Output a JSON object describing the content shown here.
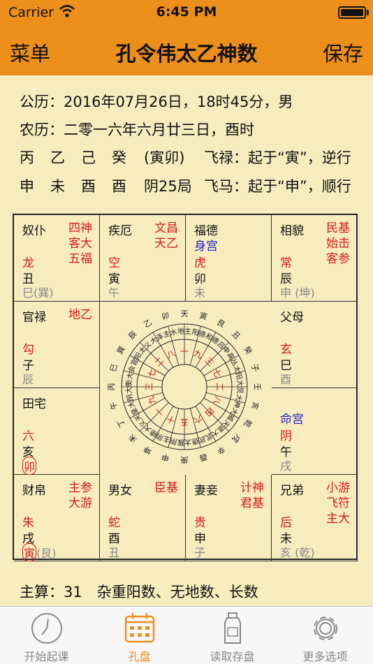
{
  "status_bar": {
    "carrier": "Carrier",
    "time": "6:45 PM"
  },
  "nav": {
    "left": "菜单",
    "title": "孔令伟太乙神数",
    "right": "保存"
  },
  "info": {
    "gregorian": "公历：2016年07月26日，18时45分，男",
    "lunar": "农历：二零一六年六月廿三日，酉时",
    "stems": [
      "丙",
      "乙",
      "己",
      "癸"
    ],
    "stems_extra": "(寅卯)",
    "feilu": "飞禄：起于“寅”，逆行",
    "branches": [
      "申",
      "未",
      "酉",
      "酉"
    ],
    "ju": "阴25局",
    "feima": "飞马：起于“申”，顺行"
  },
  "palaces": [
    {
      "name": "奴仆",
      "stars": [
        "四神",
        "客大",
        "五福"
      ],
      "special": "",
      "general": "龙",
      "branch": "丑",
      "extra": "巳(巽)",
      "circle_extra": ""
    },
    {
      "name": "疾厄",
      "stars": [
        "文昌",
        "天乙"
      ],
      "special": "",
      "general": "空",
      "branch": "寅",
      "extra": "午",
      "circle_extra": ""
    },
    {
      "name": "福德",
      "stars": [],
      "special": "身宫",
      "general": "虎",
      "branch": "卯",
      "extra": "未",
      "circle_extra": ""
    },
    {
      "name": "相貌",
      "stars": [
        "民基",
        "始击",
        "客参"
      ],
      "special": "",
      "general": "常",
      "branch": "辰",
      "extra": "申 (坤)",
      "circle_extra": ""
    },
    {
      "name": "官禄",
      "stars": [
        "地乙"
      ],
      "special": "",
      "general": "勾",
      "branch": "子",
      "extra": "辰",
      "circle_extra": ""
    },
    {
      "name": "父母",
      "stars": [],
      "special": "",
      "general": "玄",
      "branch": "巳",
      "extra": "酉",
      "circle_extra": ""
    },
    {
      "name": "田宅",
      "stars": [],
      "special": "",
      "general": "六",
      "branch": "亥",
      "extra": "",
      "circle_extra": "卯"
    },
    {
      "name": "",
      "stars": [],
      "special": "命宫",
      "general": "阴",
      "branch": "午",
      "extra": "戌",
      "circle_extra": ""
    },
    {
      "name": "财帛",
      "stars": [
        "主参",
        "大游"
      ],
      "special": "",
      "general": "朱",
      "branch": "戌",
      "extra": "(艮)",
      "circle_extra": "寅"
    },
    {
      "name": "男女",
      "stars": [
        "臣基"
      ],
      "special": "",
      "general": "蛇",
      "branch": "酉",
      "extra": "丑",
      "circle_extra": ""
    },
    {
      "name": "妻妾",
      "stars": [
        "计神",
        "君基"
      ],
      "special": "",
      "general": "贵",
      "branch": "申",
      "extra": "子",
      "circle_extra": ""
    },
    {
      "name": "兄弟",
      "stars": [
        "小游",
        "飞符",
        "主大"
      ],
      "special": "",
      "general": "后",
      "branch": "未",
      "extra": "亥 (乾)",
      "circle_extra": ""
    }
  ],
  "wheel": {
    "outer": [
      "天",
      "寅",
      "艮",
      "丑",
      "癸",
      "子",
      "壬",
      "亥",
      "乾",
      "戌",
      "辛",
      "酉",
      "庚",
      "申",
      "坤",
      "未",
      "丁",
      "午",
      "丙",
      "巳",
      "巽",
      "辰",
      "乙",
      "卯"
    ],
    "middle": [
      "地主",
      "阳德",
      "和德",
      "吕申",
      "高丛",
      "太阳",
      "大炅",
      "大神",
      "大威",
      "天道",
      "大武",
      "武德",
      "太簇",
      "阴主",
      "阴德",
      "大义",
      "天皇",
      "大阴",
      "大衡",
      "大会",
      "官阳",
      "太义",
      "大泽",
      "主水"
    ],
    "inner": [
      "一",
      "九",
      "三",
      "七",
      "二",
      "八",
      "四",
      "六",
      "五",
      "十",
      "一",
      "九",
      "三",
      "七",
      "二",
      "八"
    ]
  },
  "summary": "主算：31　杂重阳数、无地数、长数",
  "tabs": [
    {
      "label": "开始起课",
      "icon": "clock-icon"
    },
    {
      "label": "孔盘",
      "icon": "calendar-grid-icon"
    },
    {
      "label": "读取存盘",
      "icon": "bottle-icon"
    },
    {
      "label": "更多选项",
      "icon": "gear-icon"
    }
  ],
  "colors": {
    "accent": "#ed8f1b",
    "background": "#f7ecbe",
    "star_red": "#d41c1c",
    "special_blue": "#2222c8"
  }
}
